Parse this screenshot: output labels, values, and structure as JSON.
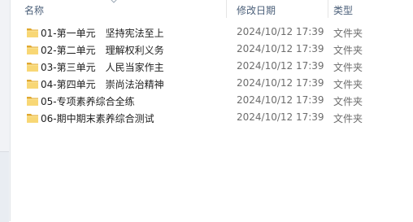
{
  "columns": {
    "name": "名称",
    "modified": "修改日期",
    "type": "类型"
  },
  "items": [
    {
      "name": "01-第一单元　坚持宪法至上",
      "modified": "2024/10/12 17:39",
      "type": "文件夹",
      "icon": "folder-icon"
    },
    {
      "name": "02-第二单元　理解权利义务",
      "modified": "2024/10/12 17:39",
      "type": "文件夹",
      "icon": "folder-icon"
    },
    {
      "name": "03-第三单元　人民当家作主",
      "modified": "2024/10/12 17:39",
      "type": "文件夹",
      "icon": "folder-icon"
    },
    {
      "name": "04-第四单元　崇尚法治精神",
      "modified": "2024/10/12 17:39",
      "type": "文件夹",
      "icon": "folder-icon"
    },
    {
      "name": "05-专项素养综合全练",
      "modified": "2024/10/12 17:39",
      "type": "文件夹",
      "icon": "folder-icon"
    },
    {
      "name": "06-期中期末素养综合测试",
      "modified": "2024/10/12 17:39",
      "type": "文件夹",
      "icon": "folder-icon"
    }
  ],
  "colors": {
    "header_text": "#4c607a",
    "folder_yellow": "#f8d775",
    "folder_dark": "#e0a82e"
  }
}
